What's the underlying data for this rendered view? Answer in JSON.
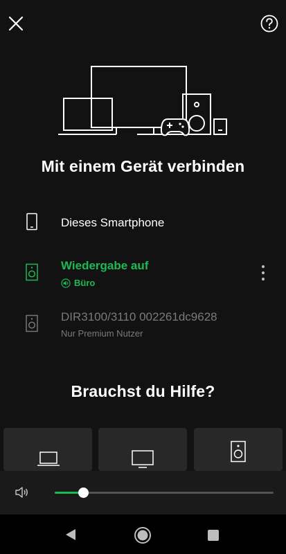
{
  "header": {
    "close_icon": "close-icon",
    "help_icon": "help-circle-icon"
  },
  "hero": {
    "illustration": "devices-illustration",
    "title": "Mit einem Gerät verbinden"
  },
  "devices": [
    {
      "name": "Dieses Smartphone",
      "subtitle": "",
      "icon": "smartphone-icon",
      "state": "normal"
    },
    {
      "name": "Wiedergabe auf",
      "subtitle": "Büro",
      "icon": "speaker-icon",
      "state": "active",
      "more_icon": "more-vertical-icon"
    },
    {
      "name": "DIR3100/3110 002261dc9628",
      "subtitle": "Nur Premium Nutzer",
      "icon": "speaker-icon",
      "state": "disabled"
    }
  ],
  "help": {
    "title": "Brauchst du Hilfe?",
    "cards": [
      {
        "icon": "laptop-icon"
      },
      {
        "icon": "tv-icon"
      },
      {
        "icon": "speaker-icon"
      }
    ]
  },
  "volume": {
    "icon": "volume-icon",
    "level": 0.13
  },
  "system_nav": {
    "back": "back-icon",
    "home": "home-icon",
    "recents": "recents-icon"
  },
  "colors": {
    "background": "#121212",
    "accent": "#1db954",
    "card": "#282828",
    "muted": "#7a7a7a"
  }
}
